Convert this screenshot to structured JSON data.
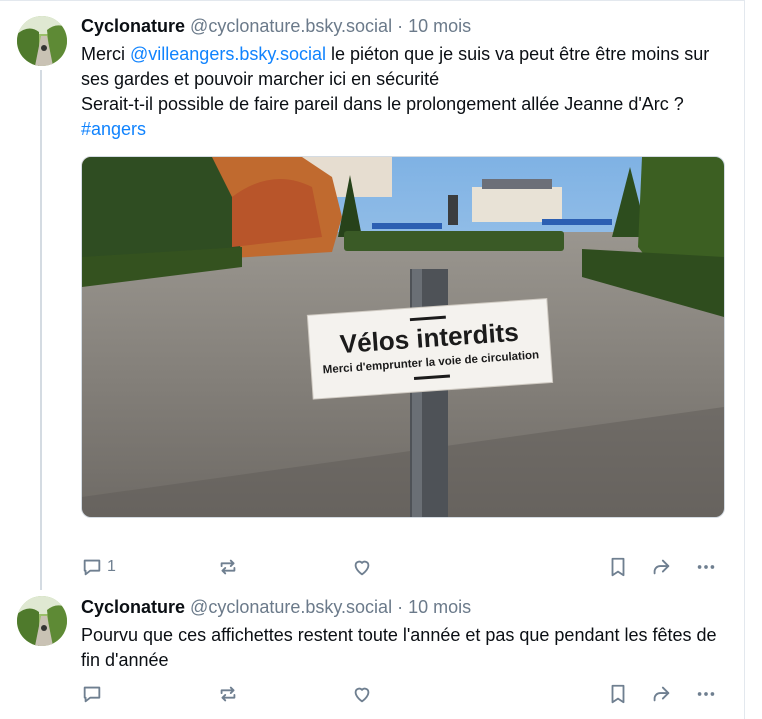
{
  "posts": [
    {
      "author_name": "Cyclonature",
      "handle": "@cyclonature.bsky.social",
      "separator": "·",
      "time": "10 mois",
      "text_before_mention": "Merci ",
      "mention": "@villeangers.bsky.social",
      "text_after_mention": " le piéton que je suis va peut être être moins sur ses gardes et pouvoir marcher ici en sécurité",
      "text_line2": "Serait-t-il possible de faire pareil dans le prolongement allée Jeanne d'Arc ?",
      "hashtag": "#angers",
      "image": {
        "sign_title": "Vélos interdits",
        "sign_subtitle": "Merci d'emprunter la voie de circulation"
      },
      "reply_count": "1",
      "icons": [
        "reply-icon",
        "repost-icon",
        "like-icon",
        "bookmark-icon",
        "share-icon",
        "more-icon"
      ]
    },
    {
      "author_name": "Cyclonature",
      "handle": "@cyclonature.bsky.social",
      "separator": "·",
      "time": "10 mois",
      "text": "Pourvu que ces affichettes restent toute l'année et pas que pendant les fêtes de fin d'année",
      "icons": [
        "reply-icon",
        "repost-icon",
        "like-icon",
        "bookmark-icon",
        "share-icon",
        "more-icon"
      ]
    }
  ]
}
